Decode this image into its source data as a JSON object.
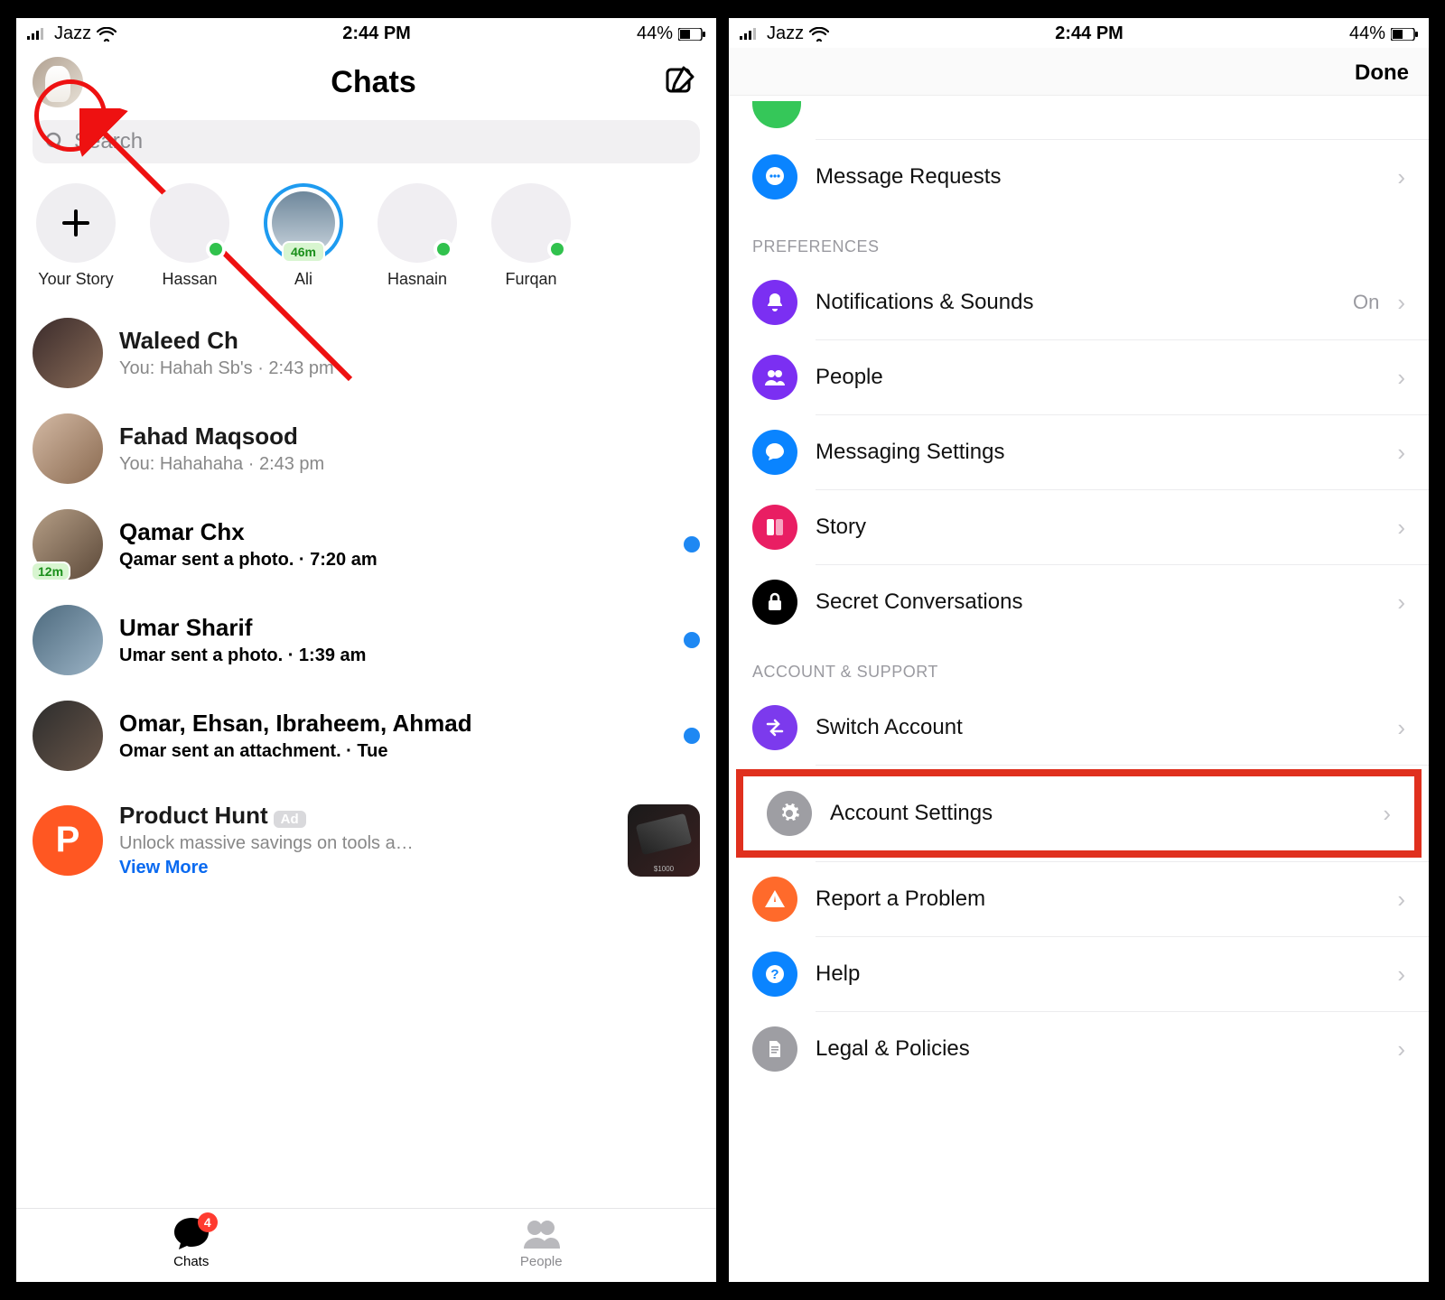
{
  "status": {
    "carrier": "Jazz",
    "time": "2:44 PM",
    "battery_pct": "44%"
  },
  "left": {
    "header_title": "Chats",
    "search_placeholder": "Search",
    "stories": [
      {
        "label": "Your Story",
        "type": "add"
      },
      {
        "label": "Hassan",
        "online": true
      },
      {
        "label": "Ali",
        "ring": true,
        "time_badge": "46m"
      },
      {
        "label": "Hasnain",
        "online": true
      },
      {
        "label": "Furqan",
        "online": true
      }
    ],
    "chats": [
      {
        "name": "Waleed Ch",
        "preview": "You: Hahah Sb's · 2:43 pm",
        "avatar": "bg-a"
      },
      {
        "name": "Fahad Maqsood",
        "preview": "You: Hahahaha · 2:43 pm",
        "avatar": "bg-b"
      },
      {
        "name": "Qamar Chx",
        "preview": "Qamar sent a photo. · 7:20 am",
        "avatar": "bg-c",
        "unread": true,
        "time_badge": "12m"
      },
      {
        "name": "Umar Sharif",
        "preview": "Umar sent a photo. · 1:39 am",
        "avatar": "bg-d",
        "unread": true
      },
      {
        "name": "Omar, Ehsan, Ibraheem, Ahmad",
        "preview": "Omar sent an attachment. · Tue",
        "avatar": "bg-e",
        "unread": true
      }
    ],
    "ad": {
      "title": "Product Hunt",
      "badge": "Ad",
      "body": "Unlock massive savings on tools a…",
      "cta": "View More",
      "img_caption": "$1000"
    },
    "tabs": {
      "chats": "Chats",
      "chats_badge": "4",
      "people": "People"
    }
  },
  "right": {
    "done": "Done",
    "rows_top": [
      {
        "label": "Message Requests",
        "color": "ic-blue",
        "icon": "chat-dots-icon"
      }
    ],
    "section_preferences": "PREFERENCES",
    "rows_preferences": [
      {
        "label": "Notifications & Sounds",
        "value": "On",
        "color": "ic-purple",
        "icon": "bell-icon"
      },
      {
        "label": "People",
        "color": "ic-purple",
        "icon": "people-icon"
      },
      {
        "label": "Messaging Settings",
        "color": "ic-blue",
        "icon": "chat-bubble-icon"
      },
      {
        "label": "Story",
        "color": "ic-pink",
        "icon": "story-icon"
      },
      {
        "label": "Secret Conversations",
        "color": "ic-black",
        "icon": "lock-icon"
      }
    ],
    "section_account": "ACCOUNT & SUPPORT",
    "rows_account": [
      {
        "label": "Switch Account",
        "color": "ic-violet",
        "icon": "switch-icon"
      },
      {
        "label": "Account Settings",
        "color": "ic-gray",
        "icon": "gear-icon",
        "highlight": true
      },
      {
        "label": "Report a Problem",
        "color": "ic-orange",
        "icon": "warning-icon"
      },
      {
        "label": "Help",
        "color": "ic-blue",
        "icon": "question-icon"
      },
      {
        "label": "Legal & Policies",
        "color": "ic-gray",
        "icon": "document-icon"
      }
    ]
  }
}
